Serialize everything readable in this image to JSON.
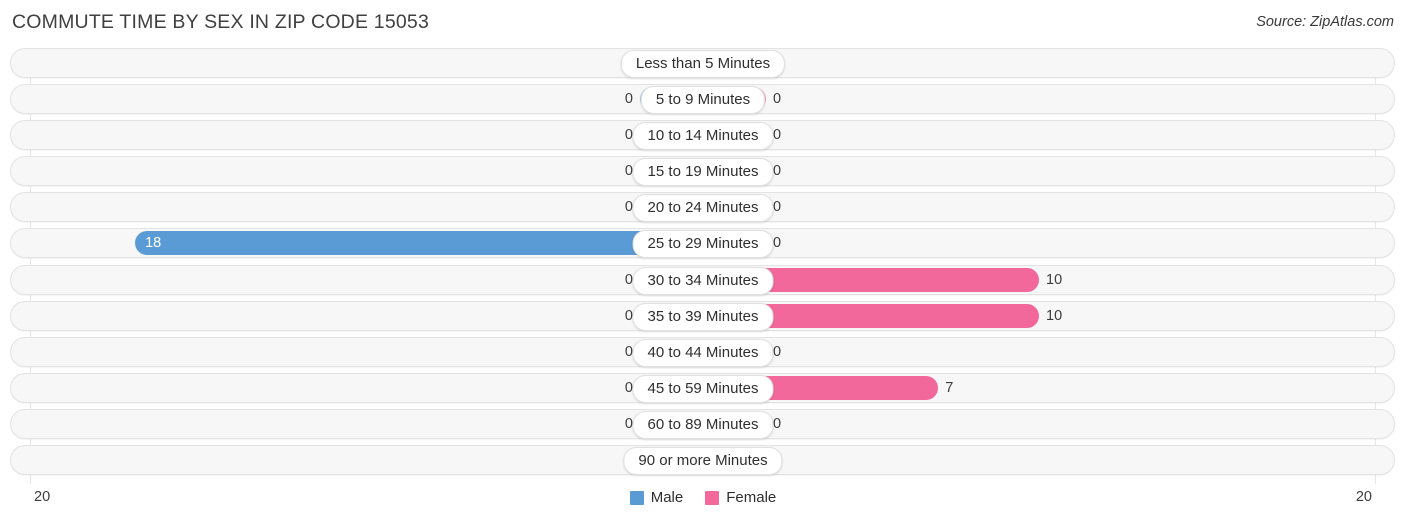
{
  "header": {
    "title": "COMMUTE TIME BY SEX IN ZIP CODE 15053",
    "source": "Source: ZipAtlas.com"
  },
  "legend": {
    "male_label": "Male",
    "female_label": "Female",
    "male_color": "#5b9bd5",
    "female_color": "#f2689b"
  },
  "axis": {
    "left_label": "20",
    "right_label": "20"
  },
  "colors": {
    "male_strong": "#5b9bd5",
    "male_muted": "#a8c8ec",
    "female_strong": "#f2689b",
    "female_muted": "#f6a5c0",
    "track": "#f7f7f7",
    "gridline": "#e6e6e6"
  },
  "chart_data": {
    "type": "bar",
    "title": "COMMUTE TIME BY SEX IN ZIP CODE 15053",
    "subtitle": "Source: ZipAtlas.com",
    "orientation": "horizontal-diverging",
    "xlabel": "",
    "ylabel": "",
    "xlim": [
      20,
      20
    ],
    "axis_left_max": 20,
    "axis_right_max": 20,
    "grid": false,
    "legend_position": "bottom-center",
    "categories": [
      "Less than 5 Minutes",
      "5 to 9 Minutes",
      "10 to 14 Minutes",
      "15 to 19 Minutes",
      "20 to 24 Minutes",
      "25 to 29 Minutes",
      "30 to 34 Minutes",
      "35 to 39 Minutes",
      "40 to 44 Minutes",
      "45 to 59 Minutes",
      "60 to 89 Minutes",
      "90 or more Minutes"
    ],
    "series": [
      {
        "name": "Male",
        "values": [
          0,
          0,
          0,
          0,
          0,
          18,
          0,
          0,
          0,
          0,
          0,
          0
        ]
      },
      {
        "name": "Female",
        "values": [
          0,
          0,
          0,
          0,
          0,
          0,
          10,
          10,
          0,
          7,
          0,
          0
        ]
      }
    ]
  },
  "rows": [
    {
      "label": "Less than 5 Minutes",
      "male": "0",
      "female": "0"
    },
    {
      "label": "5 to 9 Minutes",
      "male": "0",
      "female": "0"
    },
    {
      "label": "10 to 14 Minutes",
      "male": "0",
      "female": "0"
    },
    {
      "label": "15 to 19 Minutes",
      "male": "0",
      "female": "0"
    },
    {
      "label": "20 to 24 Minutes",
      "male": "0",
      "female": "0"
    },
    {
      "label": "25 to 29 Minutes",
      "male": "18",
      "female": "0"
    },
    {
      "label": "30 to 34 Minutes",
      "male": "0",
      "female": "10"
    },
    {
      "label": "35 to 39 Minutes",
      "male": "0",
      "female": "10"
    },
    {
      "label": "40 to 44 Minutes",
      "male": "0",
      "female": "0"
    },
    {
      "label": "45 to 59 Minutes",
      "male": "0",
      "female": "7"
    },
    {
      "label": "60 to 89 Minutes",
      "male": "0",
      "female": "0"
    },
    {
      "label": "90 or more Minutes",
      "male": "0",
      "female": "0"
    }
  ]
}
